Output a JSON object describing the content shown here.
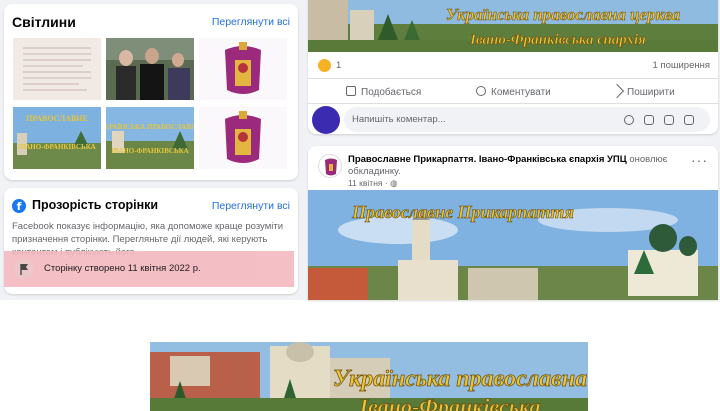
{
  "photos_card": {
    "title": "Світлини",
    "see_all": "Переглянути всі"
  },
  "transparency_card": {
    "title": "Прозорість сторінки",
    "see_all": "Переглянути всі",
    "description": "Facebook показує інформацію, яка допоможе краще розуміти призначення сторінки. Перегляньте дії людей, які керують контентом і публікують його.",
    "created": "Сторінку створено 11 квітня 2022 р."
  },
  "post1": {
    "banner_text_line1": "Українська православна церква",
    "banner_text_line2": "Івано-Франківська єпархія",
    "reactions_count": "1",
    "shares": "1 поширення",
    "actions": {
      "like": "Подобається",
      "comment": "Коментувати",
      "share": "Поширити"
    },
    "comment_placeholder": "Напишіть коментар..."
  },
  "post2": {
    "page_name": "Православне Прикарпаття. Івано-Франківська єпархія УПЦ",
    "action_text": "оновлює обкладинку.",
    "date": "11 квітня",
    "banner_text": "Православне Прикарпаття"
  },
  "bottom_image": {
    "text_line1": "Українська православна",
    "text_line2": "Івано-Франківська"
  },
  "colors": {
    "accent": "#216fdb",
    "highlight": "#f3b8bf",
    "banner_text": "#e8c53a"
  }
}
